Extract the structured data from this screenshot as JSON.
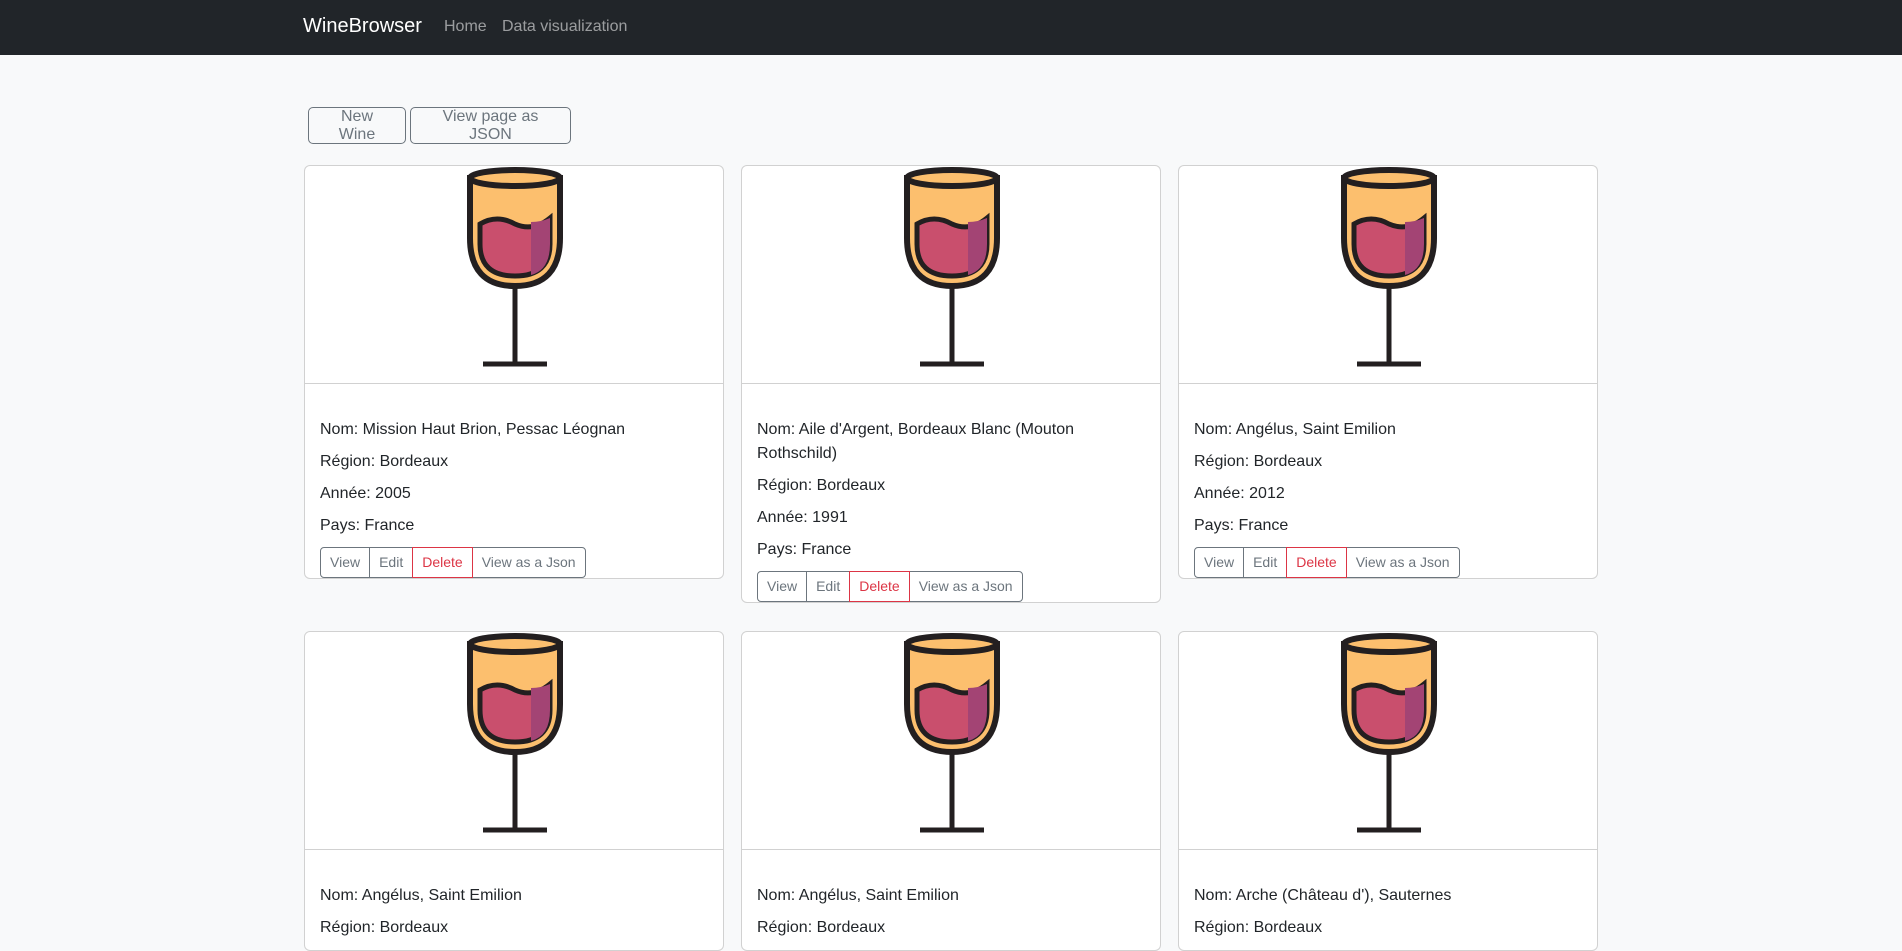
{
  "navbar": {
    "brand": "WineBrowser",
    "links": [
      "Home",
      "Data visualization"
    ]
  },
  "toolbar": {
    "new_wine": "New Wine",
    "view_json": "View page as JSON"
  },
  "card_actions": {
    "view": "View",
    "edit": "Edit",
    "delete": "Delete",
    "json": "View as a Json"
  },
  "wines": [
    {
      "nom": "Nom: Mission Haut Brion, Pessac Léognan",
      "region": "Région: Bordeaux",
      "annee": "Année: 2005",
      "pays": "Pays: France"
    },
    {
      "nom": "Nom: Aile d'Argent, Bordeaux Blanc (Mouton Rothschild)",
      "region": "Région: Bordeaux",
      "annee": "Année: 1991",
      "pays": "Pays: France"
    },
    {
      "nom": "Nom: Angélus, Saint Emilion",
      "region": "Région: Bordeaux",
      "annee": "Année: 2012",
      "pays": "Pays: France"
    },
    {
      "nom": "Nom: Angélus, Saint Emilion",
      "region": "Région: Bordeaux"
    },
    {
      "nom": "Nom: Angélus, Saint Emilion",
      "region": "Région: Bordeaux"
    },
    {
      "nom": "Nom: Arche (Château d'), Sauternes",
      "region": "Région: Bordeaux"
    }
  ],
  "colors": {
    "navbar": "#212529",
    "glass": "#fcbf6e",
    "wine": "#c94f6d",
    "wine_shade": "#a34474",
    "outline": "#231f20",
    "danger": "#dc3545",
    "secondary": "#6c757d"
  }
}
